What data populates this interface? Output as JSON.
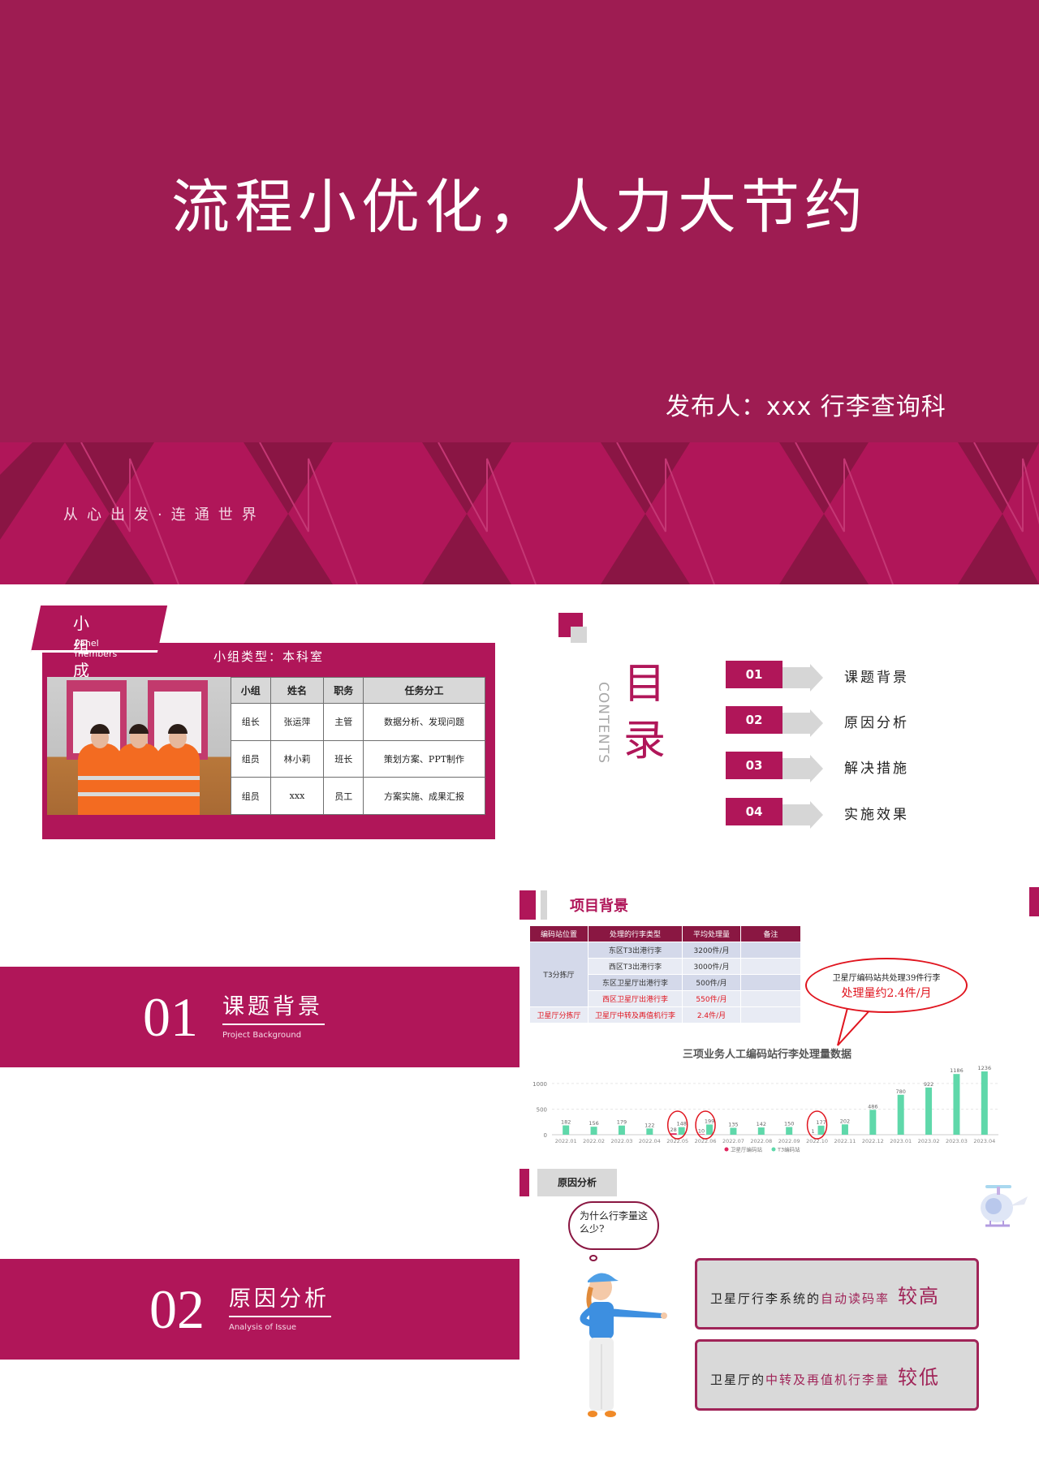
{
  "cover": {
    "title": "流程小优化，人力大节约",
    "publisher": "发布人：xxx   行李查询科",
    "slogan": "从心出发·连通世界"
  },
  "team": {
    "tag_title": "小组成员",
    "tag_subtitle": "Panel members",
    "type_label": "小组类型：本科室",
    "headers": [
      "小组",
      "姓名",
      "职务",
      "任务分工"
    ],
    "rows": [
      [
        "组长",
        "张运萍",
        "主管",
        "数据分析、发现问题"
      ],
      [
        "组员",
        "林小莉",
        "班长",
        "策划方案、PPT制作"
      ],
      [
        "组员",
        "xxx",
        "员工",
        "方案实施、成果汇报"
      ]
    ]
  },
  "contents": {
    "title_cn": "目录",
    "title_en": "CONTENTS",
    "items": [
      {
        "num": "01",
        "label": "课题背景"
      },
      {
        "num": "02",
        "label": "原因分析"
      },
      {
        "num": "03",
        "label": "解决措施"
      },
      {
        "num": "04",
        "label": "实施效果"
      }
    ]
  },
  "section1": {
    "num": "01",
    "title": "课题背景",
    "subtitle": "Project Background"
  },
  "section2": {
    "num": "02",
    "title": "原因分析",
    "subtitle": "Analysis of Issue"
  },
  "project_background": {
    "title": "项目背景",
    "headers": [
      "编码站位置",
      "处理的行李类型",
      "平均处理量",
      "备注"
    ],
    "group1": "T3分拣厅",
    "group2": "卫星厅分拣厅",
    "rows": [
      {
        "type": "东区T3出港行李",
        "volume": "3200件/月",
        "note": ""
      },
      {
        "type": "西区T3出港行李",
        "volume": "3000件/月",
        "note": ""
      },
      {
        "type": "东区卫星厅出港行李",
        "volume": "500件/月",
        "note": ""
      },
      {
        "type": "西区卫星厅出港行李",
        "volume": "550件/月",
        "note": ""
      },
      {
        "type": "卫星厅中转及再值机行李",
        "volume": "2.4件/月",
        "note": ""
      }
    ],
    "callout_line1": "卫星厅编码站共处理39件行李",
    "callout_line2": "处理量约2.4件/月"
  },
  "chart_data": {
    "type": "bar",
    "title": "三项业务人工编码站行李处理量数据",
    "categories": [
      "2022.01",
      "2022.02",
      "2022.03",
      "2022.04",
      "2022.05",
      "2022.06",
      "2022.07",
      "2022.08",
      "2022.09",
      "2022.10",
      "2022.11",
      "2022.12",
      "2023.01",
      "2023.02",
      "2023.03",
      "2023.04"
    ],
    "series": [
      {
        "name": "卫星厅编码站",
        "color": "#e0245e",
        "values": [
          null,
          null,
          null,
          null,
          28,
          10,
          null,
          null,
          null,
          1,
          null,
          null,
          null,
          null,
          null,
          null
        ]
      },
      {
        "name": "T3编码站",
        "color": "#5fd8aa",
        "values": [
          182,
          156,
          179,
          122,
          148,
          199,
          135,
          142,
          150,
          177,
          202,
          486,
          780,
          922,
          1186,
          1236
        ]
      }
    ],
    "highlighted": [
      "2022.05",
      "2022.06",
      "2022.10"
    ],
    "yticks": [
      0,
      500,
      1000
    ],
    "ylim": [
      0,
      1300
    ],
    "grid": true,
    "legend": "bottom-center",
    "xlabel": "",
    "ylabel": ""
  },
  "cause_analysis": {
    "tab": "原因分析",
    "question": "为什么行李量这么少?",
    "reasons": [
      {
        "prefix": "卫星厅行李系统的",
        "highlight": "自动读码率",
        "emphasis": "较高"
      },
      {
        "prefix": "卫星厅的",
        "highlight": "中转及再值机行李量",
        "emphasis": "较低"
      }
    ]
  }
}
